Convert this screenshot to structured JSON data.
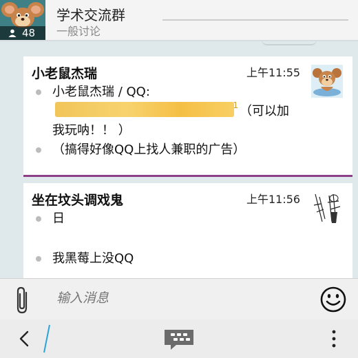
{
  "header": {
    "title": "学术交流群",
    "subtitle": "一般讨论",
    "member_count": "48",
    "group_icon": "jerry-mouse-avatar",
    "person_icon": "person-icon"
  },
  "messages": [
    {
      "sender": "小老鼠杰瑞",
      "time": "上午11:55",
      "avatar": "jerry-mouse-avatar",
      "lines": [
        {
          "text_1": "小老鼠杰瑞 / QQ:",
          "redacted": true,
          "text_2": "（可以加",
          "text_3": "我玩呐！！ ）"
        },
        {
          "text_1": "（搞得好像QQ上找人兼职的广告）"
        }
      ]
    },
    {
      "sender": "坐在坟头调戏鬼",
      "time": "上午11:56",
      "avatar": "sketch-figure-avatar",
      "lines": [
        {
          "text_1": "日"
        },
        {
          "text_1": "我黑莓上没QQ"
        }
      ]
    }
  ],
  "composer": {
    "placeholder": "输入消息",
    "attach_icon": "paperclip-icon",
    "emoji_icon": "smiley-icon"
  },
  "actionbar": {
    "back_icon": "back-chevron-icon",
    "bbm_icon": "bbm-icon",
    "more_icon": "more-vertical-icon"
  },
  "colors": {
    "divider": "#8c3f87",
    "background": "#dfe9ec",
    "header_avatar_bg": "#3f7f86"
  }
}
